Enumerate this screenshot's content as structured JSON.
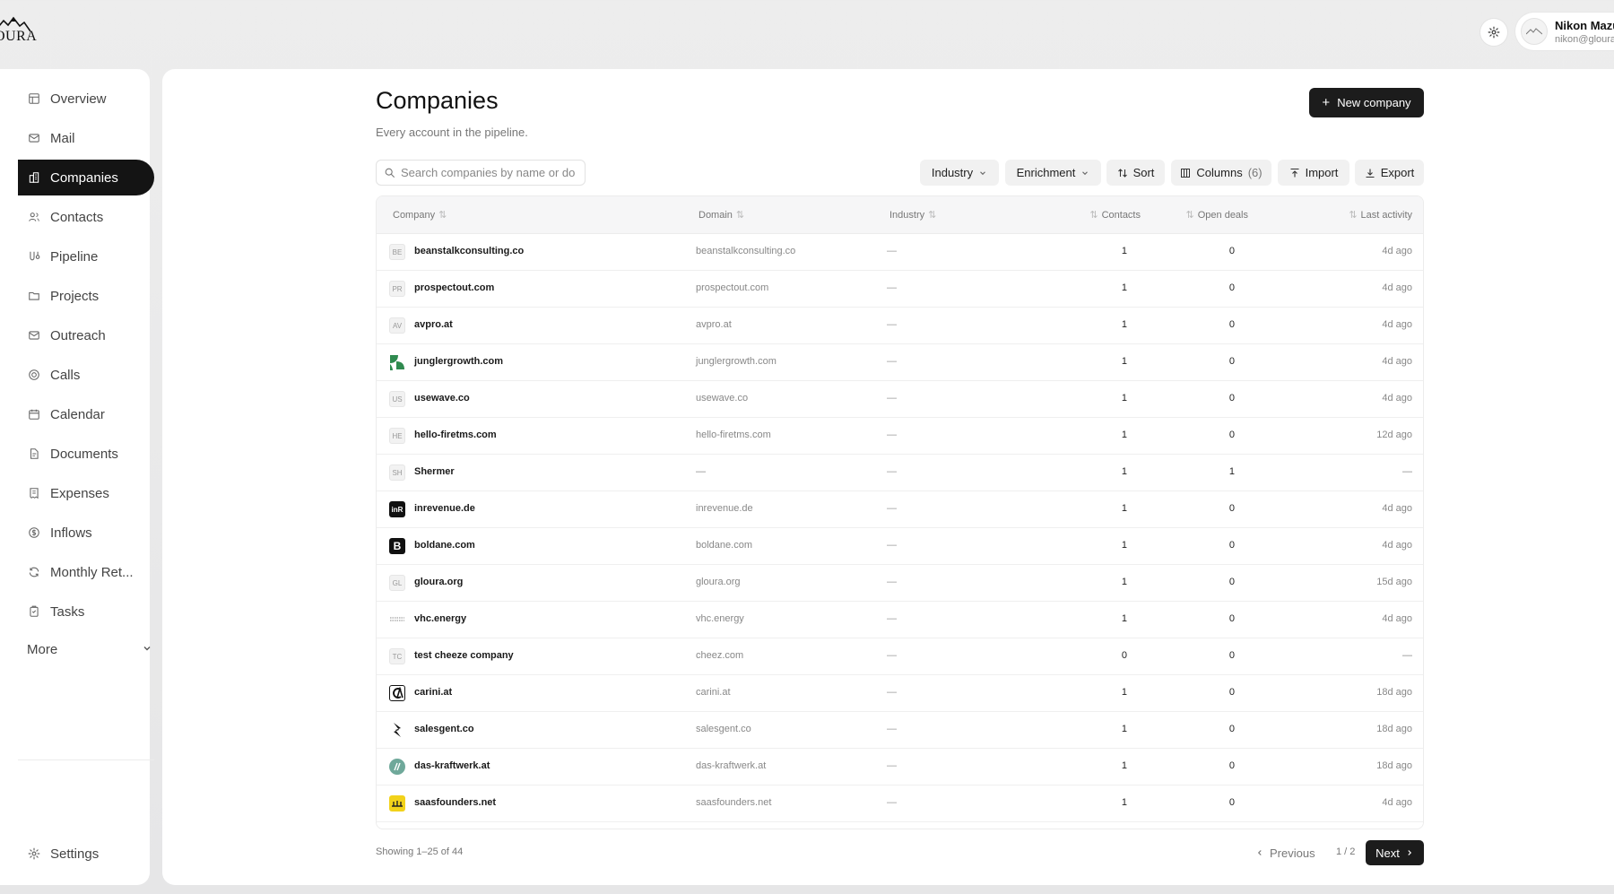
{
  "brand": {
    "logo_text": "OURA"
  },
  "user": {
    "name": "Nikon Mazu",
    "email": "nikon@gloura"
  },
  "sidebar": {
    "items": [
      {
        "label": "Overview",
        "icon": "overview-icon"
      },
      {
        "label": "Mail",
        "icon": "mail-icon"
      },
      {
        "label": "Companies",
        "icon": "building-icon",
        "active": true
      },
      {
        "label": "Contacts",
        "icon": "users-icon"
      },
      {
        "label": "Pipeline",
        "icon": "pipeline-icon"
      },
      {
        "label": "Projects",
        "icon": "folder-icon"
      },
      {
        "label": "Outreach",
        "icon": "outreach-icon"
      },
      {
        "label": "Calls",
        "icon": "calls-icon"
      },
      {
        "label": "Calendar",
        "icon": "calendar-icon"
      },
      {
        "label": "Documents",
        "icon": "documents-icon"
      },
      {
        "label": "Expenses",
        "icon": "receipt-icon"
      },
      {
        "label": "Inflows",
        "icon": "dollar-icon"
      },
      {
        "label": "Monthly Ret...",
        "icon": "refresh-icon"
      },
      {
        "label": "Tasks",
        "icon": "clipboard-icon"
      }
    ],
    "more_label": "More",
    "settings_label": "Settings"
  },
  "page": {
    "title": "Companies",
    "subtitle": "Every account in the pipeline.",
    "new_button": "New company"
  },
  "toolbar": {
    "search_placeholder": "Search companies by name or do",
    "industry": "Industry",
    "enrichment": "Enrichment",
    "sort": "Sort",
    "columns": "Columns",
    "columns_count": "(6)",
    "import": "Import",
    "export": "Export"
  },
  "table": {
    "headers": {
      "company": "Company",
      "domain": "Domain",
      "industry": "Industry",
      "contacts": "Contacts",
      "open_deals": "Open deals",
      "last_activity": "Last activity"
    },
    "rows": [
      {
        "logo": "BE",
        "logo_type": "init",
        "name": "beanstalkconsulting.co",
        "domain": "beanstalkconsulting.co",
        "industry": "—",
        "contacts": "1",
        "deals": "0",
        "activity": "4d ago"
      },
      {
        "logo": "PR",
        "logo_type": "init",
        "name": "prospectout.com",
        "domain": "prospectout.com",
        "industry": "—",
        "contacts": "1",
        "deals": "0",
        "activity": "4d ago"
      },
      {
        "logo": "AV",
        "logo_type": "init",
        "name": "avpro.at",
        "domain": "avpro.at",
        "industry": "—",
        "contacts": "1",
        "deals": "0",
        "activity": "4d ago"
      },
      {
        "logo": "",
        "logo_type": "leaf",
        "name": "junglergrowth.com",
        "domain": "junglergrowth.com",
        "industry": "—",
        "contacts": "1",
        "deals": "0",
        "activity": "4d ago"
      },
      {
        "logo": "US",
        "logo_type": "init",
        "name": "usewave.co",
        "domain": "usewave.co",
        "industry": "—",
        "contacts": "1",
        "deals": "0",
        "activity": "4d ago"
      },
      {
        "logo": "HE",
        "logo_type": "init",
        "name": "hello-firetms.com",
        "domain": "hello-firetms.com",
        "industry": "—",
        "contacts": "1",
        "deals": "0",
        "activity": "12d ago"
      },
      {
        "logo": "SH",
        "logo_type": "init",
        "name": "Shermer",
        "domain": "—",
        "industry": "—",
        "contacts": "1",
        "deals": "1",
        "activity": "—"
      },
      {
        "logo": "inR",
        "logo_type": "dark",
        "name": "inrevenue.de",
        "domain": "inrevenue.de",
        "industry": "—",
        "contacts": "1",
        "deals": "0",
        "activity": "4d ago"
      },
      {
        "logo": "B",
        "logo_type": "dark",
        "name": "boldane.com",
        "domain": "boldane.com",
        "industry": "—",
        "contacts": "1",
        "deals": "0",
        "activity": "4d ago"
      },
      {
        "logo": "GL",
        "logo_type": "init",
        "name": "gloura.org",
        "domain": "gloura.org",
        "industry": "—",
        "contacts": "1",
        "deals": "0",
        "activity": "15d ago"
      },
      {
        "logo": "",
        "logo_type": "vhc",
        "name": "vhc.energy",
        "domain": "vhc.energy",
        "industry": "—",
        "contacts": "1",
        "deals": "0",
        "activity": "4d ago"
      },
      {
        "logo": "TC",
        "logo_type": "init",
        "name": "test cheeze company",
        "domain": "cheez.com",
        "industry": "—",
        "contacts": "0",
        "deals": "0",
        "activity": "—"
      },
      {
        "logo": "",
        "logo_type": "carini",
        "name": "carini.at",
        "domain": "carini.at",
        "industry": "—",
        "contacts": "1",
        "deals": "0",
        "activity": "18d ago"
      },
      {
        "logo": "",
        "logo_type": "salesgent",
        "name": "salesgent.co",
        "domain": "salesgent.co",
        "industry": "—",
        "contacts": "1",
        "deals": "0",
        "activity": "18d ago"
      },
      {
        "logo": "",
        "logo_type": "kraft",
        "name": "das-kraftwerk.at",
        "domain": "das-kraftwerk.at",
        "industry": "—",
        "contacts": "1",
        "deals": "0",
        "activity": "18d ago"
      },
      {
        "logo": "",
        "logo_type": "saas",
        "name": "saasfounders.net",
        "domain": "saasfounders.net",
        "industry": "—",
        "contacts": "1",
        "deals": "0",
        "activity": "4d ago"
      }
    ]
  },
  "footer": {
    "showing": "Showing 1–25 of 44",
    "previous": "Previous",
    "page_indicator": "1 / 2",
    "next": "Next"
  },
  "colors": {
    "accent": "#141414",
    "leaf": "#2f8a4f",
    "kraft": "#6fa89a",
    "saas": "#f2d21a"
  }
}
